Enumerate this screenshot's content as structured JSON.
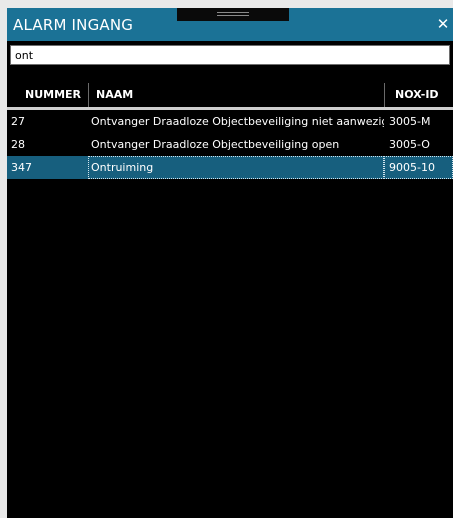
{
  "window": {
    "title": "ALARM INGANG",
    "close_icon": "close-icon",
    "grip_icon": "drag-handle-icon"
  },
  "search": {
    "value": "ont",
    "placeholder": ""
  },
  "table": {
    "columns": [
      "NUMMER",
      "NAAM",
      "NOX-ID"
    ],
    "rows": [
      {
        "nummer": "27",
        "naam": "Ontvanger Draadloze Objectbeveiliging niet aanwezig",
        "nox_id": "3005-M"
      },
      {
        "nummer": "28",
        "naam": "Ontvanger Draadloze Objectbeveiliging open",
        "nox_id": "3005-O"
      },
      {
        "nummer": "347",
        "naam": "Ontruiming",
        "nox_id": "9005-10"
      }
    ],
    "selected_index": 2
  },
  "colors": {
    "titlebar": "#1b7296",
    "selected_row": "#175f7e",
    "background": "#000000"
  }
}
